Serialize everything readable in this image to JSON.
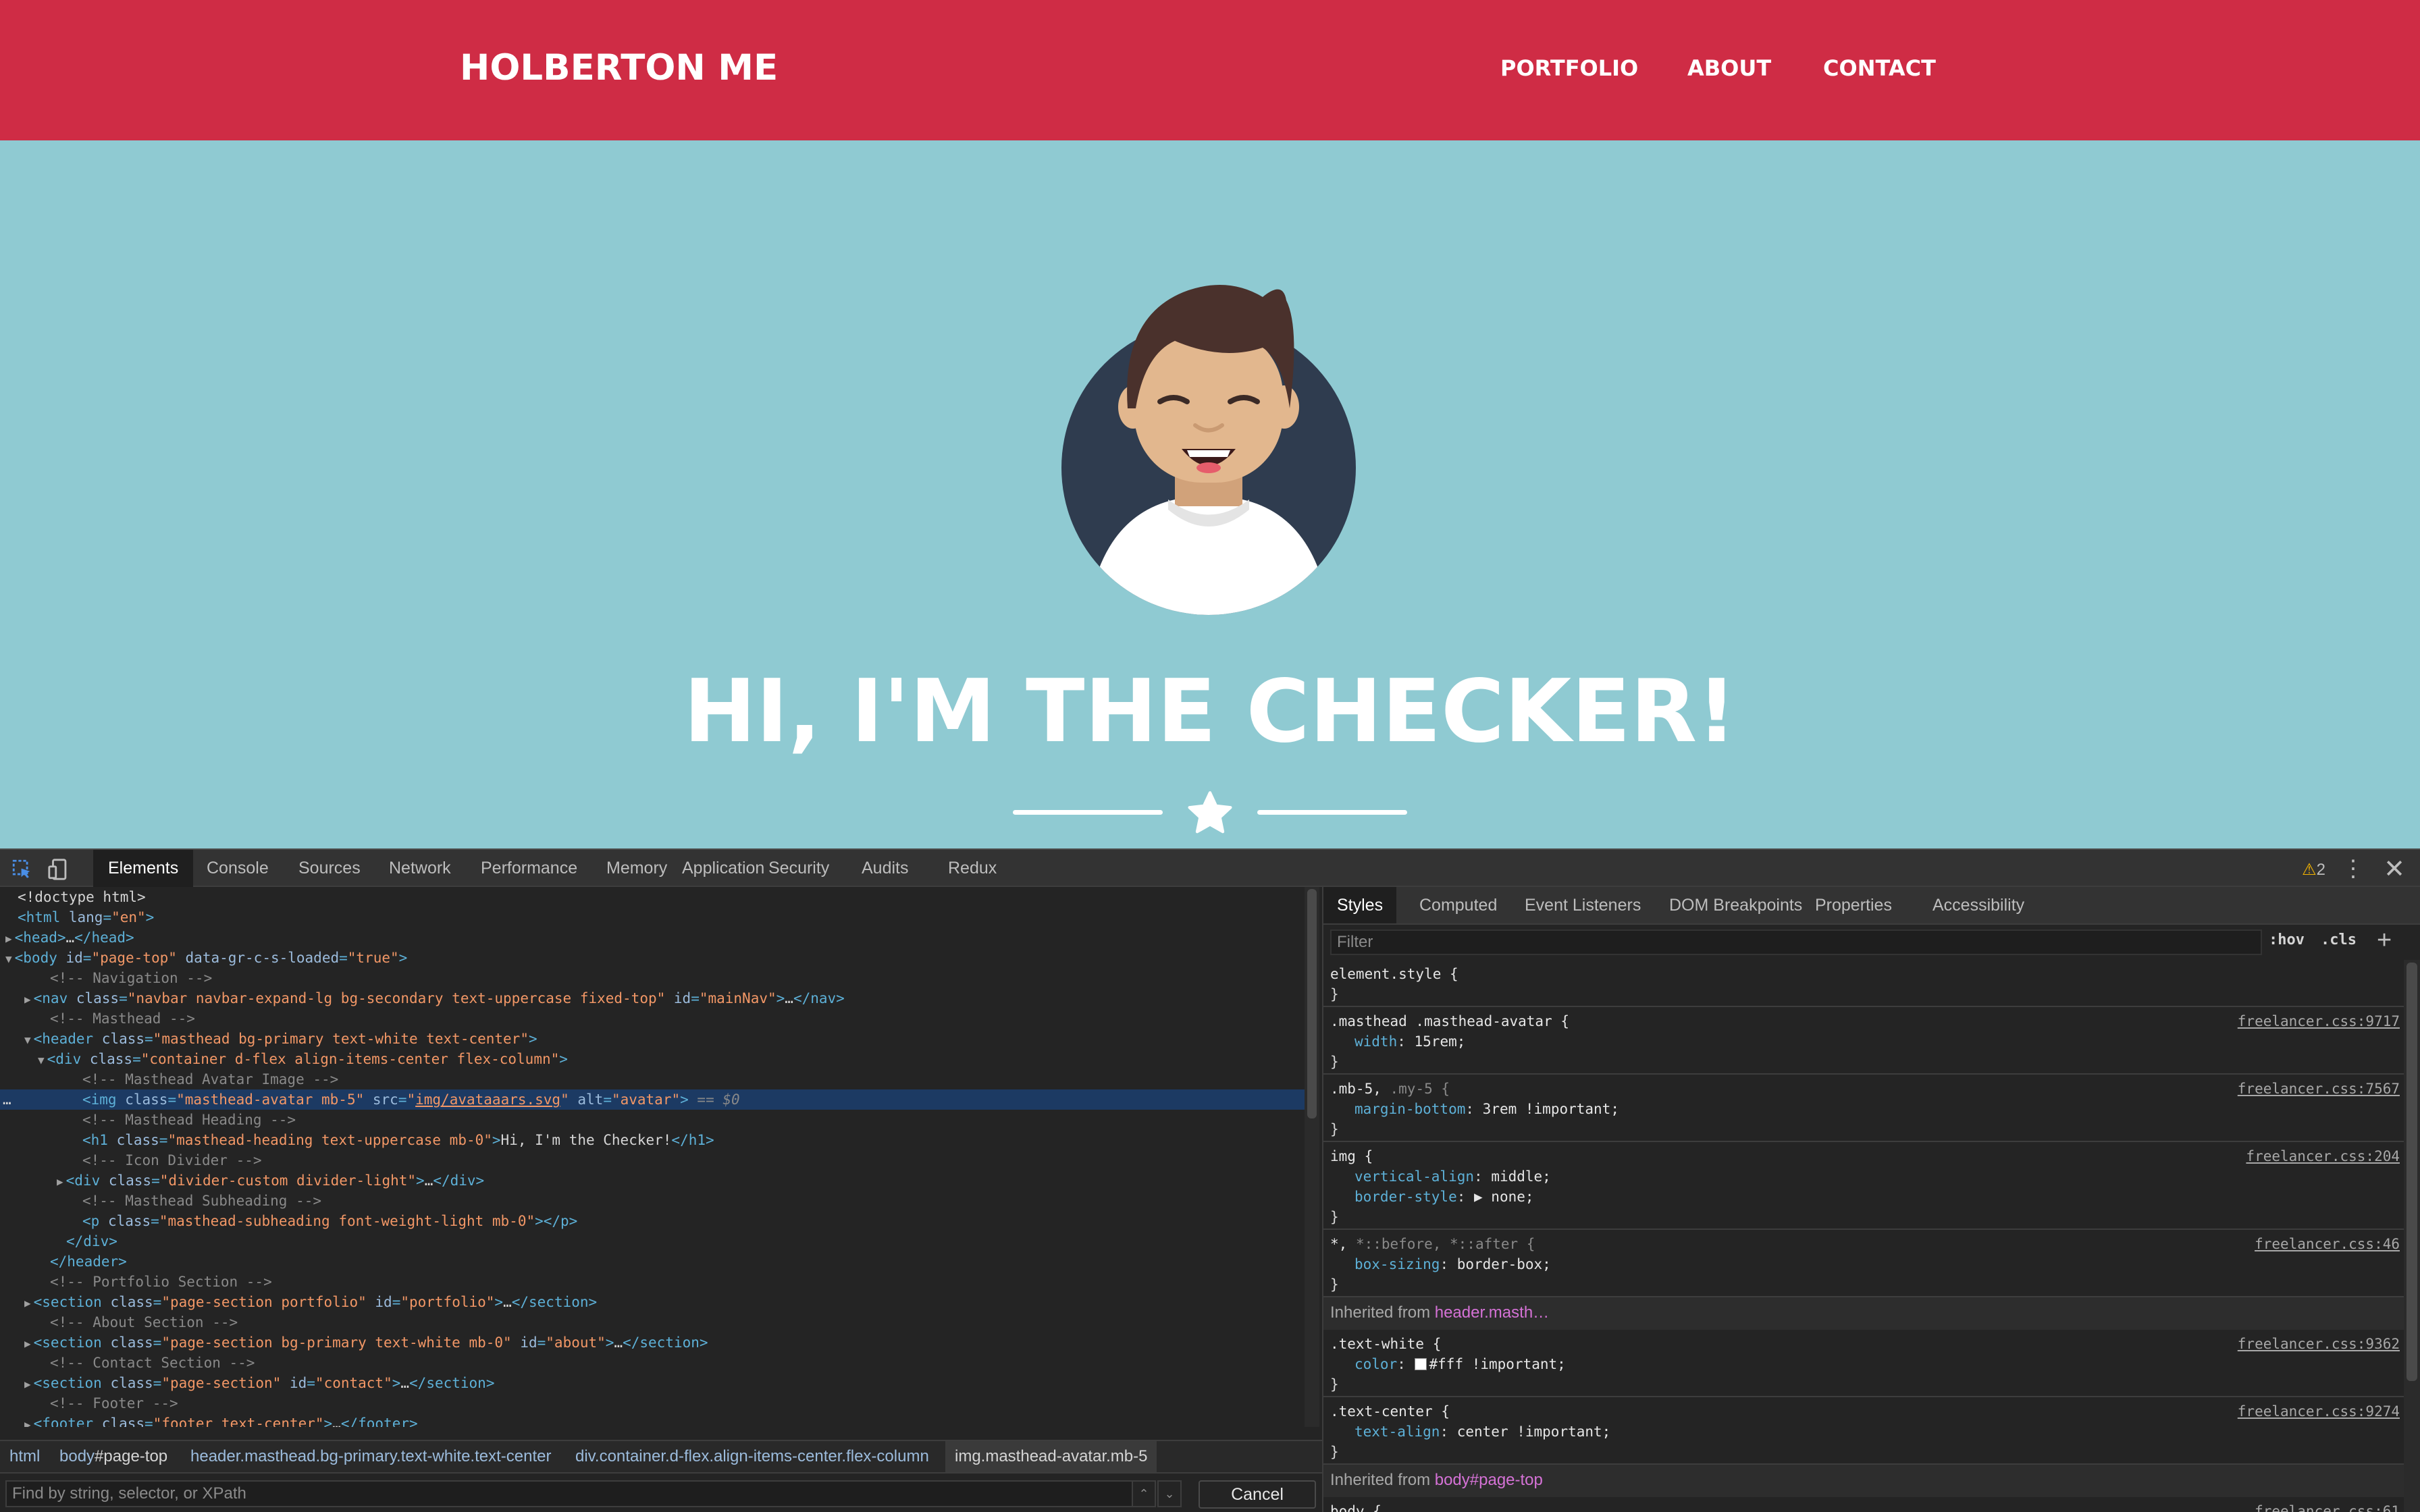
{
  "site": {
    "brand": "HOLBERTON ME",
    "nav": [
      "PORTFOLIO",
      "ABOUT",
      "CONTACT"
    ],
    "heading": "HI, I'M THE CHECKER!",
    "colors": {
      "navbar": "#cf2c45",
      "masthead": "#8fcad2",
      "text": "#ffffff"
    }
  },
  "devtools": {
    "tabs": [
      "Elements",
      "Console",
      "Sources",
      "Network",
      "Performance",
      "Memory",
      "Application",
      "Security",
      "Audits",
      "Redux"
    ],
    "warnings": "2",
    "dom": [
      {
        "parts": [
          [
            "tx",
            "<!doctype html>"
          ]
        ]
      },
      {
        "parts": [
          [
            "tg",
            "<html "
          ],
          [
            "an",
            "lang"
          ],
          [
            "tg",
            "="
          ],
          [
            "av",
            "\"en\""
          ],
          [
            "tg",
            ">"
          ]
        ]
      },
      {
        "parts": [
          [
            "tri-r",
            "▶"
          ],
          [
            "tg",
            "<head>"
          ],
          [
            "tx",
            "…"
          ],
          [
            "tg",
            "</head>"
          ]
        ]
      },
      {
        "parts": [
          [
            "tri-r",
            "▼"
          ],
          [
            "tg",
            "<body "
          ],
          [
            "an",
            "id"
          ],
          [
            "tg",
            "="
          ],
          [
            "av",
            "\"page-top\""
          ],
          [
            "an",
            " data-gr-c-s-loaded"
          ],
          [
            "tg",
            "="
          ],
          [
            "av",
            "\"true\""
          ],
          [
            "tg",
            ">"
          ]
        ]
      },
      {
        "parts": [
          [
            "cm",
            "<!-- Navigation -->"
          ]
        ]
      },
      {
        "parts": [
          [
            "tri-r",
            "▶"
          ],
          [
            "tg",
            "<nav "
          ],
          [
            "an",
            "class"
          ],
          [
            "tg",
            "="
          ],
          [
            "av",
            "\"navbar navbar-expand-lg bg-secondary text-uppercase fixed-top\""
          ],
          [
            "an",
            " id"
          ],
          [
            "tg",
            "="
          ],
          [
            "av",
            "\"mainNav\""
          ],
          [
            "tg",
            ">"
          ],
          [
            "tx",
            "…"
          ],
          [
            "tg",
            "</nav>"
          ]
        ]
      },
      {
        "parts": [
          [
            "cm",
            "<!-- Masthead -->"
          ]
        ]
      },
      {
        "parts": [
          [
            "tri-r",
            "▼"
          ],
          [
            "tg",
            "<header "
          ],
          [
            "an",
            "class"
          ],
          [
            "tg",
            "="
          ],
          [
            "av",
            "\"masthead bg-primary text-white text-center\""
          ],
          [
            "tg",
            ">"
          ]
        ]
      },
      {
        "parts": [
          [
            "tri-r",
            "▼"
          ],
          [
            "tg",
            "<div "
          ],
          [
            "an",
            "class"
          ],
          [
            "tg",
            "="
          ],
          [
            "av",
            "\"container d-flex align-items-center flex-column\""
          ],
          [
            "tg",
            ">"
          ]
        ]
      },
      {
        "parts": [
          [
            "cm",
            "<!-- Masthead Avatar Image -->"
          ]
        ]
      },
      {
        "parts": [
          [
            "tg",
            "<img "
          ],
          [
            "an",
            "class"
          ],
          [
            "tg",
            "="
          ],
          [
            "av",
            "\"masthead-avatar mb-5\""
          ],
          [
            "an",
            " src"
          ],
          [
            "tg",
            "="
          ],
          [
            "av",
            "\""
          ],
          [
            "lk",
            "img/avataaars.svg"
          ],
          [
            "av",
            "\""
          ],
          [
            "an",
            " alt"
          ],
          [
            "tg",
            "="
          ],
          [
            "av",
            "\"avatar\""
          ],
          [
            "tg",
            ">"
          ],
          [
            "eq",
            " == $0"
          ]
        ]
      },
      {
        "parts": [
          [
            "cm",
            "<!-- Masthead Heading -->"
          ]
        ]
      },
      {
        "parts": [
          [
            "tg",
            "<h1 "
          ],
          [
            "an",
            "class"
          ],
          [
            "tg",
            "="
          ],
          [
            "av",
            "\"masthead-heading text-uppercase mb-0\""
          ],
          [
            "tg",
            ">"
          ],
          [
            "tx",
            "Hi, I'm the Checker!"
          ],
          [
            "tg",
            "</h1>"
          ]
        ]
      },
      {
        "parts": [
          [
            "cm",
            "<!-- Icon Divider -->"
          ]
        ]
      },
      {
        "parts": [
          [
            "tri-r",
            "▶"
          ],
          [
            "tg",
            "<div "
          ],
          [
            "an",
            "class"
          ],
          [
            "tg",
            "="
          ],
          [
            "av",
            "\"divider-custom divider-light\""
          ],
          [
            "tg",
            ">"
          ],
          [
            "tx",
            "…"
          ],
          [
            "tg",
            "</div>"
          ]
        ]
      },
      {
        "parts": [
          [
            "cm",
            "<!-- Masthead Subheading -->"
          ]
        ]
      },
      {
        "parts": [
          [
            "tg",
            "<p "
          ],
          [
            "an",
            "class"
          ],
          [
            "tg",
            "="
          ],
          [
            "av",
            "\"masthead-subheading font-weight-light mb-0\""
          ],
          [
            "tg",
            "></p>"
          ]
        ]
      },
      {
        "parts": [
          [
            "tg",
            "</div>"
          ]
        ]
      },
      {
        "parts": [
          [
            "tg",
            "</header>"
          ]
        ]
      },
      {
        "parts": [
          [
            "cm",
            "<!-- Portfolio Section -->"
          ]
        ]
      },
      {
        "parts": [
          [
            "tri-r",
            "▶"
          ],
          [
            "tg",
            "<section "
          ],
          [
            "an",
            "class"
          ],
          [
            "tg",
            "="
          ],
          [
            "av",
            "\"page-section portfolio\""
          ],
          [
            "an",
            " id"
          ],
          [
            "tg",
            "="
          ],
          [
            "av",
            "\"portfolio\""
          ],
          [
            "tg",
            ">"
          ],
          [
            "tx",
            "…"
          ],
          [
            "tg",
            "</section>"
          ]
        ]
      },
      {
        "parts": [
          [
            "cm",
            "<!-- About Section -->"
          ]
        ]
      },
      {
        "parts": [
          [
            "tri-r",
            "▶"
          ],
          [
            "tg",
            "<section "
          ],
          [
            "an",
            "class"
          ],
          [
            "tg",
            "="
          ],
          [
            "av",
            "\"page-section bg-primary text-white mb-0\""
          ],
          [
            "an",
            " id"
          ],
          [
            "tg",
            "="
          ],
          [
            "av",
            "\"about\""
          ],
          [
            "tg",
            ">"
          ],
          [
            "tx",
            "…"
          ],
          [
            "tg",
            "</section>"
          ]
        ]
      },
      {
        "parts": [
          [
            "cm",
            "<!-- Contact Section -->"
          ]
        ]
      },
      {
        "parts": [
          [
            "tri-r",
            "▶"
          ],
          [
            "tg",
            "<section "
          ],
          [
            "an",
            "class"
          ],
          [
            "tg",
            "="
          ],
          [
            "av",
            "\"page-section\""
          ],
          [
            "an",
            " id"
          ],
          [
            "tg",
            "="
          ],
          [
            "av",
            "\"contact\""
          ],
          [
            "tg",
            ">"
          ],
          [
            "tx",
            "…"
          ],
          [
            "tg",
            "</section>"
          ]
        ]
      },
      {
        "parts": [
          [
            "cm",
            "<!-- Footer -->"
          ]
        ]
      },
      {
        "parts": [
          [
            "tri-r",
            "▶"
          ],
          [
            "tg",
            "<footer "
          ],
          [
            "an",
            "class"
          ],
          [
            "tg",
            "="
          ],
          [
            "av",
            "\"footer text-center\""
          ],
          [
            "tg",
            ">"
          ],
          [
            "tx",
            "…"
          ],
          [
            "tg",
            "</footer>"
          ]
        ]
      }
    ],
    "breadcrumbs": [
      {
        "tag": "html",
        "id": ""
      },
      {
        "tag": "body",
        "id": "#page-top"
      },
      {
        "tag": "header",
        "id": ".masthead.bg-primary.text-white.text-center"
      },
      {
        "tag": "div",
        "id": ".container.d-flex.align-items-center.flex-column"
      },
      {
        "tag": "img",
        "id": ".masthead-avatar.mb-5"
      }
    ],
    "find_placeholder": "Find by string, selector, or XPath",
    "cancel_label": "Cancel",
    "styles_tabs": [
      "Styles",
      "Computed",
      "Event Listeners",
      "DOM Breakpoints",
      "Properties",
      "Accessibility"
    ],
    "filter_placeholder": "Filter",
    "hov_label": ":hov",
    "cls_label": ".cls",
    "rules": [
      {
        "selector": "element.style {",
        "dim": "",
        "source": "",
        "props": []
      },
      {
        "selector": ".masthead .masthead-avatar {",
        "dim": "",
        "source": "freelancer.css:9717",
        "props": [
          [
            "width",
            "15rem;"
          ]
        ]
      },
      {
        "selector": ".mb-5, ",
        "dim": ".my-5 {",
        "source": "freelancer.css:7567",
        "props": [
          [
            "margin-bottom",
            "3rem !important;"
          ]
        ]
      },
      {
        "selector": "img {",
        "dim": "",
        "source": "freelancer.css:204",
        "props": [
          [
            "vertical-align",
            "middle;"
          ],
          [
            "border-style",
            "▶ none;"
          ]
        ]
      },
      {
        "selector": "*, ",
        "dim": "*::before, *::after {",
        "source": "freelancer.css:46",
        "props": [
          [
            "box-sizing",
            "border-box;"
          ]
        ]
      }
    ],
    "inherited_1": {
      "label": "Inherited from ",
      "el": "header.masth…"
    },
    "rules_2": [
      {
        "selector": ".text-white {",
        "source": "freelancer.css:9362",
        "props": [
          [
            "color",
            "#fff !important;"
          ]
        ]
      },
      {
        "selector": ".text-center {",
        "source": "freelancer.css:9274",
        "props": [
          [
            "text-align",
            "center !important;"
          ]
        ]
      }
    ],
    "inherited_2": {
      "label": "Inherited from ",
      "el": "body#page-top"
    },
    "last_rule": {
      "selector": "body {",
      "source": "freelancer.css:61"
    }
  }
}
